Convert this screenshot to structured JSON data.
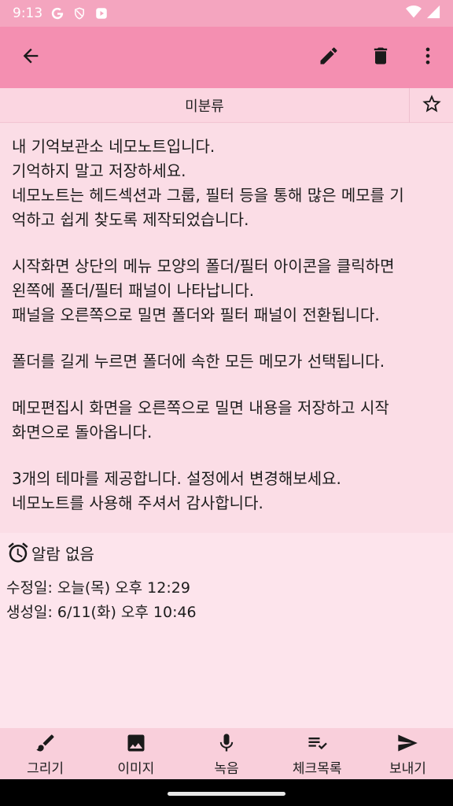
{
  "status_bar": {
    "time": "9:13",
    "icons": [
      "google-g-icon",
      "shield-icon",
      "play-store-icon",
      "wifi-icon",
      "signal-icon"
    ]
  },
  "app_bar": {
    "icons": [
      "arrow-back-icon",
      "pencil-icon",
      "trash-icon",
      "more-vert-icon"
    ]
  },
  "category": {
    "label": "미분류"
  },
  "memo": {
    "paragraphs": [
      [
        "내 기억보관소 네모노트입니다.",
        "기억하지 말고 저장하세요.",
        "네모노트는 헤드섹션과 그룹, 필터 등을 통해 많은 메모를 기",
        "억하고 쉽게 찾도록 제작되었습니다."
      ],
      [
        "시작화면 상단의 메뉴 모양의 폴더/필터 아이콘을 클릭하면",
        "왼쪽에 폴더/필터 패널이 나타납니다.",
        "패널을 오른쪽으로 밀면 폴더와 필터 패널이 전환됩니다."
      ],
      [
        "폴더를 길게 누르면 폴더에 속한 모든 메모가 선택됩니다."
      ],
      [
        "메모편집시 화면을 오른쪽으로 밀면 내용을 저장하고 시작",
        "화면으로 돌아옵니다."
      ],
      [
        "3개의 테마를 제공합니다. 설정에서 변경해보세요.",
        "네모노트를 사용해 주셔서 감사합니다."
      ]
    ]
  },
  "info": {
    "alarm": "알람 없음",
    "modified": "수정일: 오늘(목) 오후 12:29",
    "created": "생성일: 6/11(화) 오후 10:46"
  },
  "bottom_bar": {
    "items": [
      {
        "label": "그리기",
        "icon": "brush-icon"
      },
      {
        "label": "이미지",
        "icon": "image-icon"
      },
      {
        "label": "녹음",
        "icon": "mic-icon"
      },
      {
        "label": "체크목록",
        "icon": "checklist-icon"
      },
      {
        "label": "보내기",
        "icon": "send-icon"
      }
    ]
  },
  "colors": {
    "app_bar": "#f48fb1",
    "status_bar": "#f4a5bf",
    "background": "#fbdde6",
    "bottom_bar": "#f9cfdb"
  }
}
